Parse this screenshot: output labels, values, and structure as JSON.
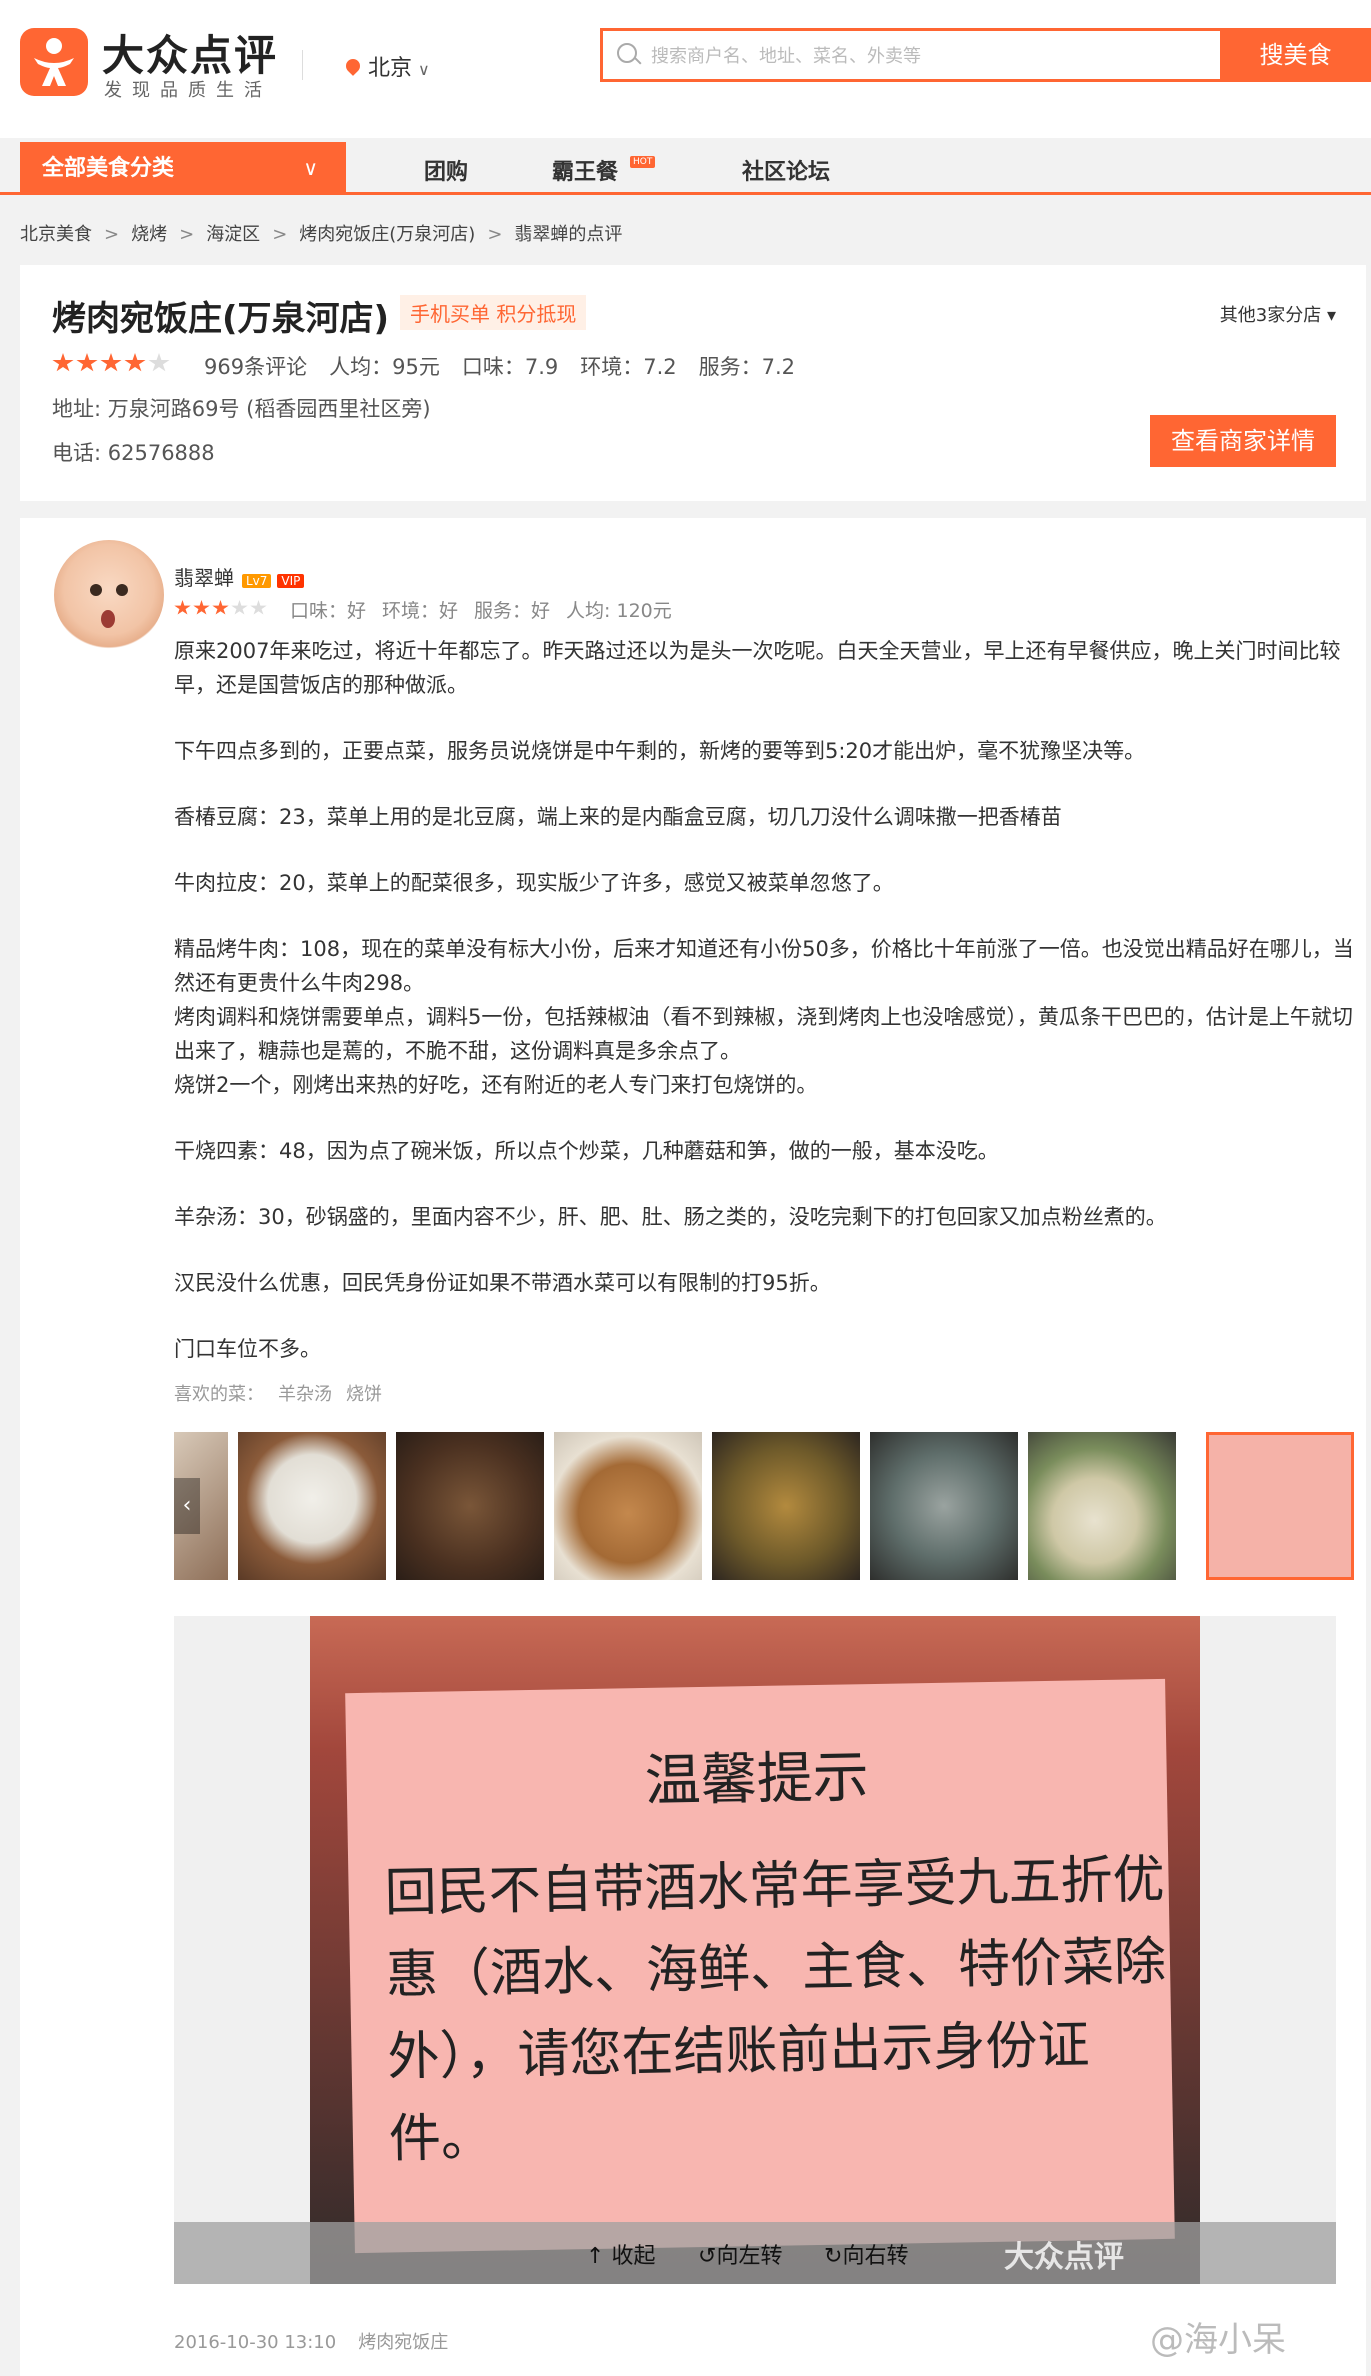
{
  "header": {
    "logo_title": "大众点评",
    "logo_slogan": "发现品质生活",
    "city": "北京",
    "search_placeholder": "搜索商户名、地址、菜名、外卖等",
    "search_button": "搜美食",
    "accent_color": "#ff6633"
  },
  "nav": {
    "category_button": "全部美食分类",
    "links": [
      "团购",
      "霸王餐",
      "社区论坛"
    ],
    "hot_badge": "HOT"
  },
  "breadcrumb": [
    "北京美食",
    "烧烤",
    "海淀区",
    "烤肉宛饭庄(万泉河店)",
    "翡翠蝉的点评"
  ],
  "shop": {
    "name": "烤肉宛饭庄(万泉河店)",
    "tag": "手机买单 积分抵现",
    "branches": "其他3家分店",
    "rating_stars": 4,
    "reviews": "969条评论",
    "avg_price": "人均：95元",
    "taste": "口味：7.9",
    "environment": "环境：7.2",
    "service": "服务：7.2",
    "address": "地址: 万泉河路69号 (稻香园西里社区旁)",
    "phone": "电话: 62576888",
    "detail_button": "查看商家详情"
  },
  "review": {
    "user": "翡翠蝉",
    "level_badge": "Lv7",
    "vip_badge": "VIP",
    "rating_stars": 3,
    "scores": [
      "口味：好",
      "环境：好",
      "服务：好",
      "人均: 120元"
    ],
    "paragraphs": [
      "原来2007年来吃过，将近十年都忘了。昨天路过还以为是头一次吃呢。白天全天营业，早上还有早餐供应，晚上关门时间比较早，还是国营饭店的那种做派。",
      "下午四点多到的，正要点菜，服务员说烧饼是中午剩的，新烤的要等到5:20才能出炉，毫不犹豫坚决等。",
      "香椿豆腐：23，菜单上用的是北豆腐，端上来的是内酯盒豆腐，切几刀没什么调味撒一把香椿苗",
      "牛肉拉皮：20，菜单上的配菜很多，现实版少了许多，感觉又被菜单忽悠了。",
      "精品烤牛肉：108，现在的菜单没有标大小份，后来才知道还有小份50多，价格比十年前涨了一倍。也没觉出精品好在哪儿，当然还有更贵什么牛肉298。",
      "烤肉调料和烧饼需要单点，调料5一份，包括辣椒油（看不到辣椒，浇到烤肉上也没啥感觉），黄瓜条干巴巴的，估计是上午就切出来了，糖蒜也是蔫的，不脆不甜，这份调料真是多余点了。",
      "烧饼2一个，刚烤出来热的好吃，还有附近的老人专门来打包烧饼的。",
      "干烧四素：48，因为点了碗米饭，所以点个炒菜，几种蘑菇和笋，做的一般，基本没吃。",
      "羊杂汤：30，砂锅盛的，里面内容不少，肝、肥、肚、肠之类的，没吃完剩下的打包回家又加点粉丝煮的。",
      "汉民没什么优惠，回民凭身份证如果不带酒水菜可以有限制的打95折。",
      "门口车位不多。"
    ],
    "favorites_label": "喜欢的菜：",
    "favorites": [
      "羊杂汤",
      "烧饼"
    ],
    "photo_notice_title": "温馨提示",
    "photo_notice_text": "回民不自带酒水常年享受九五折优惠（酒水、海鲜、主食、特价菜除外），请您在结账前出示身份证件。",
    "photo_tools": [
      "收起",
      "向左转",
      "向右转"
    ],
    "photo_watermark": "大众点评",
    "date": "2016-10-30 13:10",
    "shop_ref": "烤肉宛饭庄"
  },
  "corner_watermark": "@海小呆"
}
